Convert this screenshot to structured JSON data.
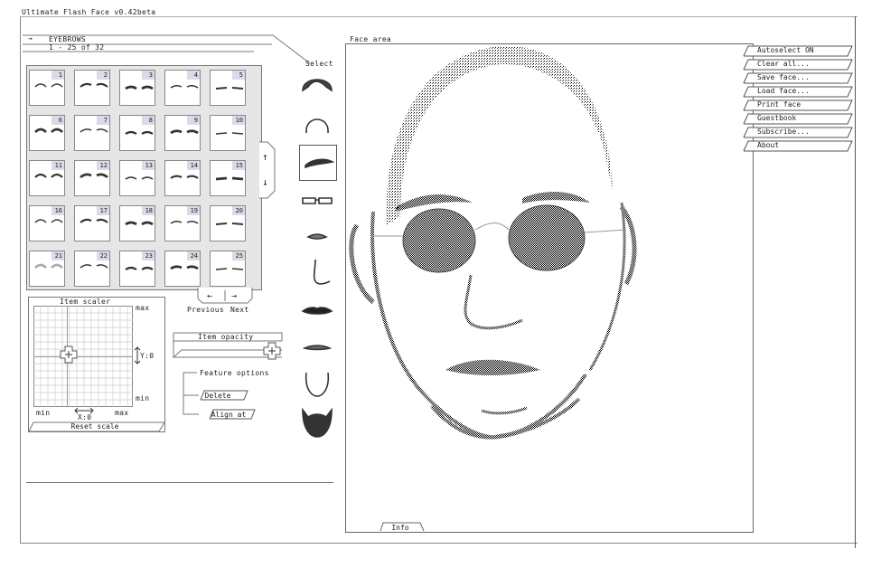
{
  "window": {
    "title": "Ultimate Flash Face v0.42beta"
  },
  "category": {
    "arrow": "→",
    "name": "EYEBROWS",
    "range": "1 - 25 of 32"
  },
  "grid": {
    "items": [
      "1",
      "2",
      "3",
      "4",
      "5",
      "6",
      "7",
      "8",
      "9",
      "10",
      "11",
      "12",
      "13",
      "14",
      "15",
      "16",
      "17",
      "18",
      "19",
      "20",
      "21",
      "22",
      "23",
      "24",
      "25"
    ]
  },
  "scroll": {
    "up": "↑",
    "down": "↓"
  },
  "pager": {
    "prev_arrow": "←",
    "next_arrow": "→",
    "prev_label": "Previous",
    "next_label": "Next"
  },
  "select": {
    "label": "Select",
    "selected_index": 2
  },
  "scaler": {
    "title": "Item scaler",
    "max_y": "max",
    "min_y": "min",
    "min_x": "min",
    "max_x": "max",
    "y_readout": "Y:0",
    "x_readout": "X:0",
    "reset": "Reset scale"
  },
  "opacity": {
    "label": "Item opacity"
  },
  "options": {
    "title": "Feature options",
    "delete": "Delete",
    "align": "Align at"
  },
  "face": {
    "title": "Face area",
    "info": "Info"
  },
  "menu": [
    "Autoselect ON",
    "Clear all...",
    "Save face...",
    "Load face...",
    "Print face",
    "Guestbook",
    "Subscribe...",
    "About"
  ]
}
